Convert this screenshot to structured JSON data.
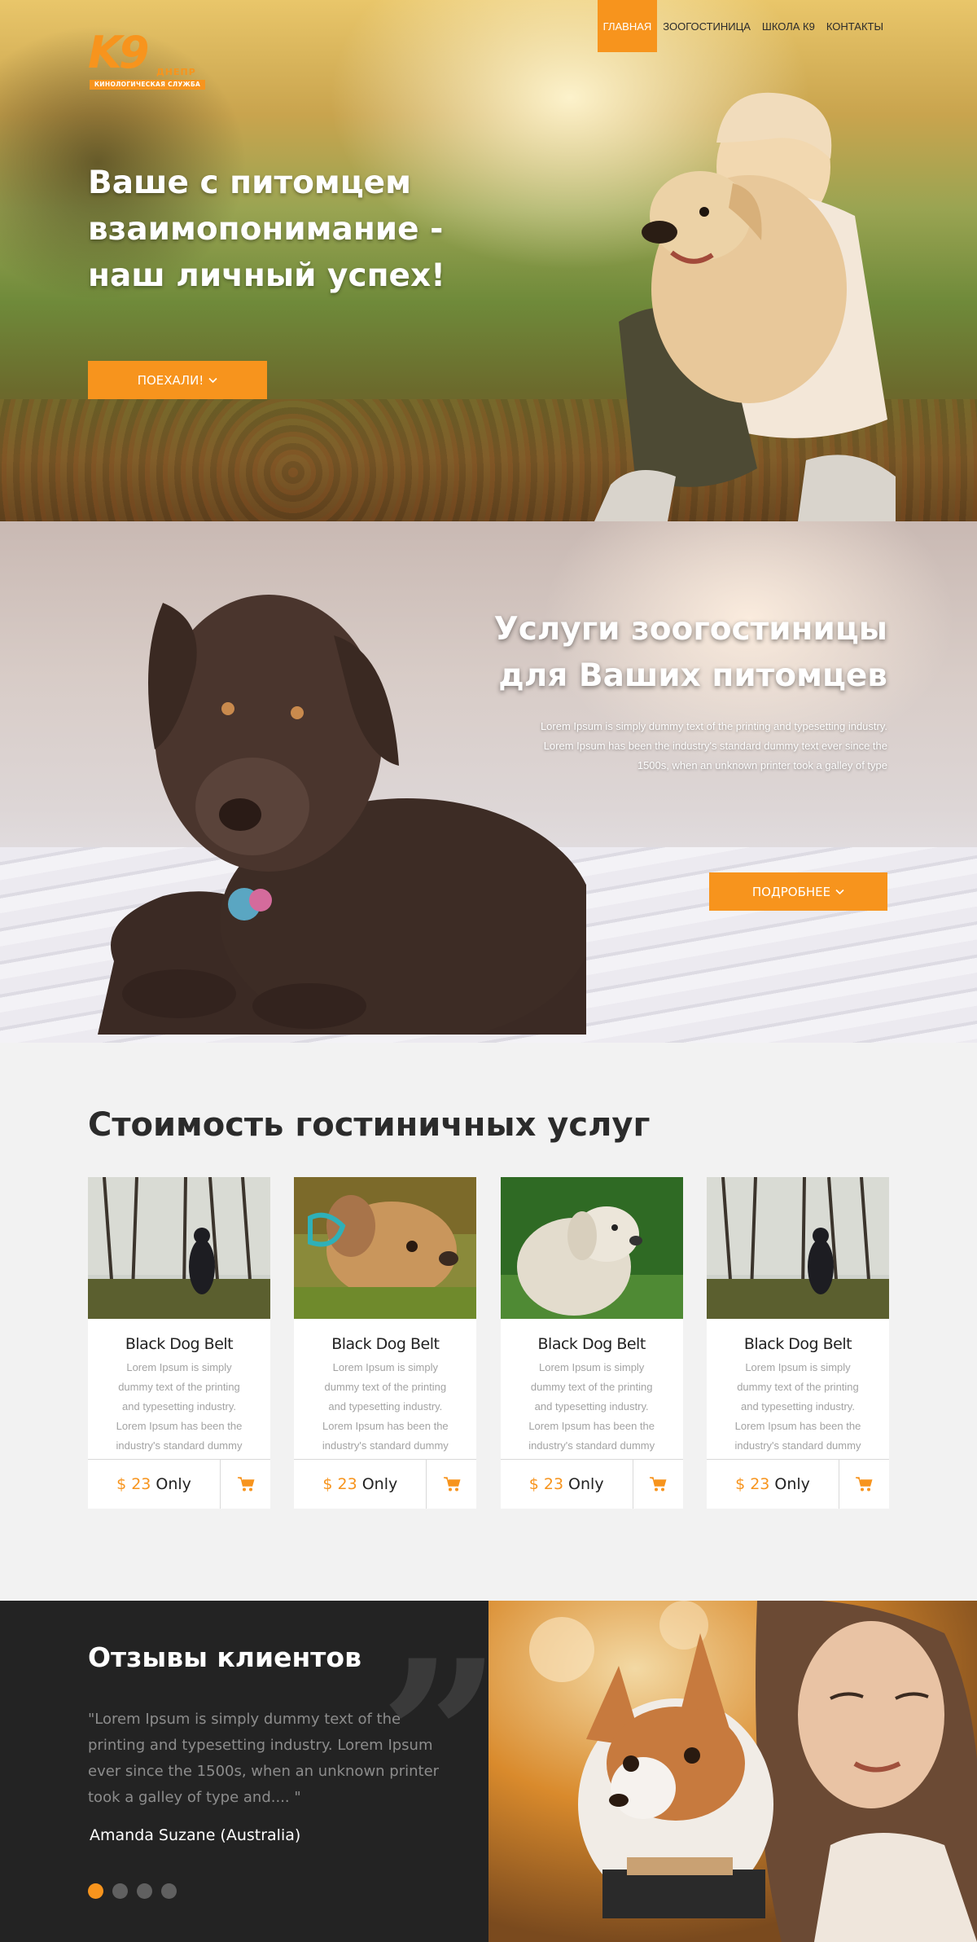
{
  "brand": {
    "logo_mark": "K9",
    "city": "ДНЕПР",
    "tagline": "КИНОЛОГИЧЕСКАЯ СЛУЖБА"
  },
  "nav": {
    "items": [
      {
        "label": "ГЛАВНАЯ",
        "active": true
      },
      {
        "label": "ЗООГОСТИНИЦА",
        "active": false
      },
      {
        "label": "ШКОЛА К9",
        "active": false
      },
      {
        "label": "КОНТАКТЫ",
        "active": false
      }
    ]
  },
  "hero": {
    "title_line1": "Ваше с питомцем",
    "title_line2": "взаимопонимание -",
    "title_line3": "наш личный успех!",
    "button_label": "ПОЕХАЛИ!"
  },
  "hotel": {
    "title_line1": "Услуги зоогостиницы",
    "title_line2": "для Ваших питомцев",
    "text": "Lorem Ipsum is simply dummy text of the printing and typesetting industry. Lorem Ipsum has been the industry's standard dummy text ever since the 1500s, when an unknown printer took a galley of type",
    "button_label": "ПОДРОБНЕЕ"
  },
  "prices": {
    "title": "Стоимость гостиничных услуг",
    "cards": [
      {
        "name": "Black Dog Belt",
        "desc": "Lorem Ipsum is simply dummy text of the printing and typesetting industry. Lorem Ipsum has been the industry's standard dummy",
        "amount": "$ 23",
        "suffix": "Only",
        "photo": "black-dog-forest"
      },
      {
        "name": "Black Dog Belt",
        "desc": "Lorem Ipsum is simply dummy text of the printing and typesetting industry. Lorem Ipsum has been the industry's standard dummy",
        "amount": "$ 23",
        "suffix": "Only",
        "photo": "puppy-grass"
      },
      {
        "name": "Black Dog Belt",
        "desc": "Lorem Ipsum is simply dummy text of the printing and typesetting industry. Lorem Ipsum has been the industry's standard dummy",
        "amount": "$ 23",
        "suffix": "Only",
        "photo": "retriever-green"
      },
      {
        "name": "Black Dog Belt",
        "desc": "Lorem Ipsum is simply dummy text of the printing and typesetting industry. Lorem Ipsum has been the industry's standard dummy",
        "amount": "$ 23",
        "suffix": "Only",
        "photo": "black-dog-forest"
      }
    ]
  },
  "reviews": {
    "title": "Отзывы клиентов",
    "quote": "\"Lorem Ipsum is simply dummy text of the printing and typesetting industry. Lorem Ipsum ever since the 1500s, when an unknown printer took a galley of type and.... \"",
    "author": "Amanda Suzane (Australia)",
    "slides_total": 4,
    "active_slide": 1
  },
  "colors": {
    "accent": "#f7941d",
    "dark": "#232323",
    "light_bg": "#f2f2f2"
  },
  "icons": [
    "chevron-down-icon",
    "cart-icon",
    "quote-icon"
  ]
}
